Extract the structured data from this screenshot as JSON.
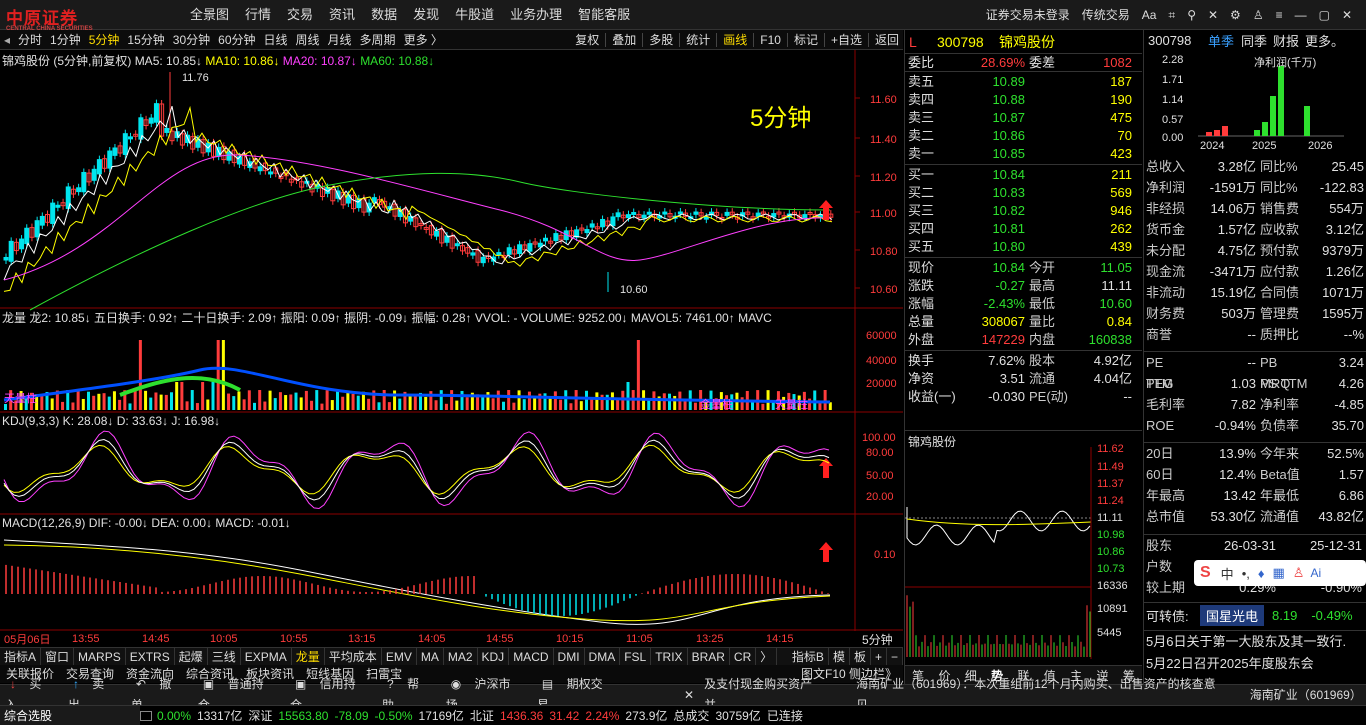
{
  "brand": {
    "logo_text": "中原证券",
    "logo_sub": "CENTRAL CHINA SECURITIES"
  },
  "nav": [
    "全景图",
    "行情",
    "交易",
    "资讯",
    "数据",
    "发现",
    "牛股道",
    "业务办理",
    "智能客服"
  ],
  "topright": [
    "证券交易未登录",
    "传统交易",
    "Aa"
  ],
  "periods": [
    "分时",
    "1分钟",
    "5分钟",
    "15分钟",
    "30分钟",
    "60分钟",
    "日线",
    "周线",
    "月线",
    "多周期",
    "更多 〉"
  ],
  "period_active": "5分钟",
  "tools": [
    "复权",
    "叠加",
    "多股",
    "统计",
    "画线",
    "F10",
    "标记",
    "+自选",
    "返回"
  ],
  "chart": {
    "title": "锦鸡股份 (5分钟,前复权)",
    "ma5": "MA5: 10.85↓",
    "ma10": "MA10: 10.86↓",
    "ma20": "MA20: 10.87↓",
    "ma60": "MA60: 10.88↓",
    "big_label": "5分钟",
    "high_label": "11.76",
    "low_label": "10.60",
    "price_ticks": [
      "11.60",
      "11.40",
      "11.20",
      "11.00",
      "10.80",
      "10.60"
    ],
    "vol_header": "龙量 龙2: 10.85↓ 五日换手: 0.92↑ 二十日换手: 2.09↑ 振阳: 0.09↑ 振阴: -0.09↓ 振幅: 0.28↑ VVOL: - VOLUME: 9252.00↓ MAVOL5: 7461.00↑ MAVC",
    "vol_ticks": [
      "60000",
      "40000",
      "20000"
    ],
    "vol_texts": [
      "天量柱",
      "金量柱",
      "天量柱"
    ],
    "kdj_header": "KDJ(9,3,3)  K: 28.08↓  D: 33.63↓  J: 16.98↓",
    "kdj_ticks": [
      "100.00",
      "80.00",
      "50.00",
      "20.00"
    ],
    "macd_header": "MACD(12,26,9)  DIF: -0.00↓  DEA: 0.00↓  MACD: -0.01↓",
    "macd_ticks": [
      "0.10"
    ],
    "time_ticks": [
      "05月06日",
      "13:55",
      "14:45",
      "10:05",
      "10:55",
      "13:15",
      "14:05",
      "14:55",
      "10:15",
      "11:05",
      "13:25",
      "14:15"
    ],
    "period_tag": "5分钟"
  },
  "stock": {
    "code": "300798",
    "name": "锦鸡股份",
    "flag": "L"
  },
  "orderbook": {
    "weibi_label": "委比",
    "weibi": "28.69%",
    "weicha_label": "委差",
    "weicha": "1082",
    "sell": [
      [
        "卖五",
        "10.89",
        "187"
      ],
      [
        "卖四",
        "10.88",
        "190"
      ],
      [
        "卖三",
        "10.87",
        "475"
      ],
      [
        "卖二",
        "10.86",
        "70"
      ],
      [
        "卖一",
        "10.85",
        "423"
      ]
    ],
    "buy": [
      [
        "买一",
        "10.84",
        "211"
      ],
      [
        "买二",
        "10.83",
        "569"
      ],
      [
        "买三",
        "10.82",
        "946"
      ],
      [
        "买四",
        "10.81",
        "262"
      ],
      [
        "买五",
        "10.80",
        "439"
      ]
    ]
  },
  "quote": [
    [
      "现价",
      "10.84",
      "今开",
      "11.05"
    ],
    [
      "涨跌",
      "-0.27",
      "最高",
      "11.11"
    ],
    [
      "涨幅",
      "-2.43%",
      "最低",
      "10.60"
    ],
    [
      "总量",
      "308067",
      "量比",
      "0.84"
    ],
    [
      "外盘",
      "147229",
      "内盘",
      "160838"
    ]
  ],
  "stats": [
    [
      "换手",
      "7.62%",
      "股本",
      "4.92亿"
    ],
    [
      "净资",
      "3.51",
      "流通",
      "4.04亿"
    ],
    [
      "收益(一)",
      "-0.030",
      "PE(动)",
      "--"
    ]
  ],
  "mini": {
    "name": "锦鸡股份",
    "ticks": [
      "11.62",
      "11.49",
      "11.37",
      "11.24",
      "11.11",
      "10.98",
      "10.86",
      "10.73",
      "16336",
      "10891",
      "5445"
    ]
  },
  "minitabs": [
    "笔",
    "价",
    "细",
    "势",
    "联",
    "值",
    "主",
    "逆",
    "筹"
  ],
  "fin": {
    "code": "300798",
    "tabs": [
      "单季",
      "同季",
      "财报",
      "更多。"
    ],
    "chart_title": "净利润(千万)",
    "yticks": [
      "2.28",
      "1.71",
      "1.14",
      "0.57",
      "0.00"
    ],
    "years": [
      "2024",
      "2025",
      "2026"
    ],
    "rows": [
      [
        "总收入",
        "3.28亿",
        "同比%",
        "25.45"
      ],
      [
        "净利润",
        "-1591万",
        "同比%",
        "-122.83"
      ],
      [
        "非经损",
        "14.06万",
        "销售费",
        "554万"
      ],
      [
        "货币金",
        "1.57亿",
        "应收款",
        "3.12亿"
      ],
      [
        "未分配",
        "4.75亿",
        "预付款",
        "9379万"
      ],
      [
        "现金流",
        "-3471万",
        "应付款",
        "1.26亿"
      ],
      [
        "非流动",
        "15.19亿",
        "合同债",
        "1071万"
      ],
      [
        "财务费",
        "503万",
        "管理费",
        "1595万"
      ],
      [
        "商誉",
        "--",
        "质押比",
        "--%"
      ]
    ],
    "rows2": [
      [
        "PE TTM",
        "--",
        "PB MRQ",
        "3.24"
      ],
      [
        "PEG",
        "1.03",
        "PS TTM",
        "4.26"
      ],
      [
        "毛利率",
        "7.82",
        "净利率",
        "-4.85"
      ],
      [
        "ROE",
        "-0.94%",
        "负债率",
        "35.70"
      ]
    ],
    "rows3": [
      [
        "20日",
        "13.9%",
        "今年来",
        "52.5%"
      ],
      [
        "60日",
        "12.4%",
        "Beta值",
        "1.57"
      ],
      [
        "年最高",
        "13.42",
        "年最低",
        "6.86"
      ],
      [
        "总市值",
        "53.30亿",
        "流通值",
        "43.82亿"
      ]
    ],
    "rows4": [
      [
        "股东",
        "26-03-31",
        "25-12-31"
      ],
      [
        "户数",
        "",
        ""
      ],
      [
        "较上期",
        "0.29%",
        "-0.90%"
      ]
    ],
    "kzz_label": "可转债:",
    "kzz_name": "国星光电",
    "kzz_price": "8.19",
    "kzz_chg": "-0.49%",
    "news": [
      "5月6日关于第一大股东及其一致行.",
      "5月22日召开2025年度股东会"
    ]
  },
  "bottom_tabs": [
    "指标A",
    "窗口",
    "MARPS",
    "EXTRS",
    "起爆",
    "三线",
    "EXPMA",
    "龙量",
    "平均成本",
    "EMV",
    "MA",
    "MA2",
    "KDJ",
    "MACD",
    "DMI",
    "DMA",
    "FSL",
    "TRIX",
    "BRAR",
    "CR",
    "〉",
    "指标B",
    "模",
    "板"
  ],
  "bottom_tab_active": "龙量",
  "links": [
    "关联报价",
    "交易查询",
    "资金流向",
    "综合资讯",
    "板块资讯",
    "短线基因",
    "扫雷宝"
  ],
  "graphtext": "图文F10 侧边栏》",
  "trade": [
    "买入",
    "卖出",
    "撤单",
    "普通持仓",
    "信用持仓",
    "帮助",
    "沪深市场",
    "期权交易"
  ],
  "notice": "及支付现金购买资产并",
  "ticker": "海南矿业（601969）：本次重组前12个月内购买、出售资产的核查意见",
  "ticker2": "海南矿业（601969）",
  "status": {
    "label": "综合选股",
    "a": "0.00%",
    "amt1": "13317亿",
    "sz_label": "深证",
    "sz": "15563.80",
    "sz_chg": "-78.09",
    "sz_pct": "-0.50%",
    "amt2": "17169亿",
    "bz_label": "北证",
    "bz": "1436.36",
    "bz_chg": "31.42",
    "bz_pct": "2.24%",
    "amt3": "273.9亿",
    "zcj_label": "总成交",
    "zcj": "30759亿",
    "conn": "已连接"
  }
}
